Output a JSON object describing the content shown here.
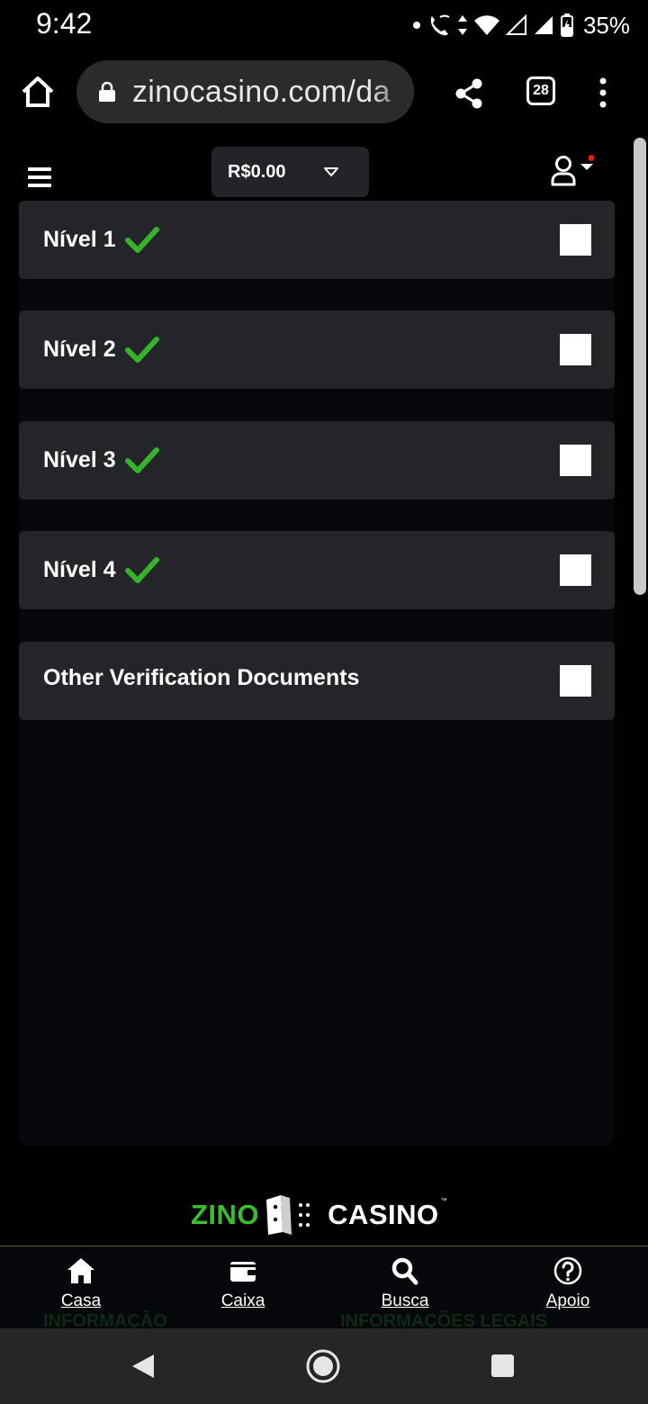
{
  "status_bar": {
    "time": "9:42",
    "battery": "35%"
  },
  "browser": {
    "url": "zinocasino.com/da",
    "tab_count": "28"
  },
  "header": {
    "balance": "R$0.00"
  },
  "levels": [
    {
      "label": "Nível 1",
      "verified": true
    },
    {
      "label": "Nível 2",
      "verified": true
    },
    {
      "label": "Nível 3",
      "verified": true
    },
    {
      "label": "Nível 4",
      "verified": true
    },
    {
      "label": "Other Verification Documents",
      "verified": false
    }
  ],
  "logo": {
    "left": "ZINO",
    "right": "CASINO",
    "tm": "™"
  },
  "bottom_nav": [
    {
      "label": "Casa",
      "icon": "home-icon"
    },
    {
      "label": "Caixa",
      "icon": "wallet-icon"
    },
    {
      "label": "Busca",
      "icon": "search-icon"
    },
    {
      "label": "Apoio",
      "icon": "help-icon"
    }
  ],
  "footer_ghost": {
    "left": "INFORMAÇÃO",
    "right": "INFORMAÇÕES LEGAIS"
  },
  "colors": {
    "accent_green": "#38c02a",
    "card": "#242528",
    "panel": "#06080c"
  }
}
